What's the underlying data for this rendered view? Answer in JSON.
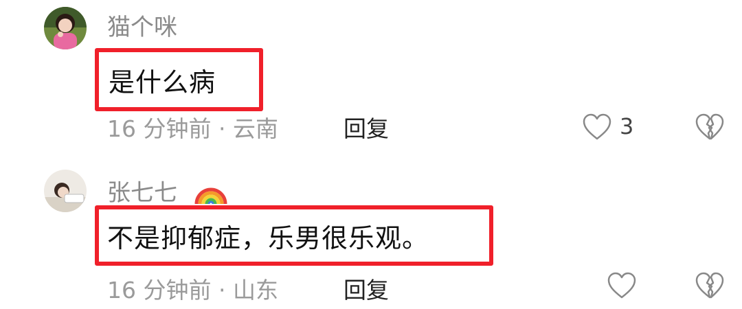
{
  "comments": [
    {
      "username": "猫个咪",
      "text": "是什么病",
      "time": "16 分钟前",
      "separator": "·",
      "location": "云南",
      "reply_label": "回复",
      "like_count": "3",
      "avatar_icon": "avatar-photo-girl"
    },
    {
      "username": "张七七",
      "badge_icon": "rainbow-emoji",
      "text": "不是抑郁症，乐男很乐观。",
      "time": "16 分钟前",
      "separator": "·",
      "location": "山东",
      "reply_label": "回复",
      "avatar_icon": "avatar-photo-reading"
    }
  ],
  "colors": {
    "highlight_border": "#f0202a",
    "meta_text": "#9a9a9a",
    "username_text": "#8a8a8a"
  }
}
